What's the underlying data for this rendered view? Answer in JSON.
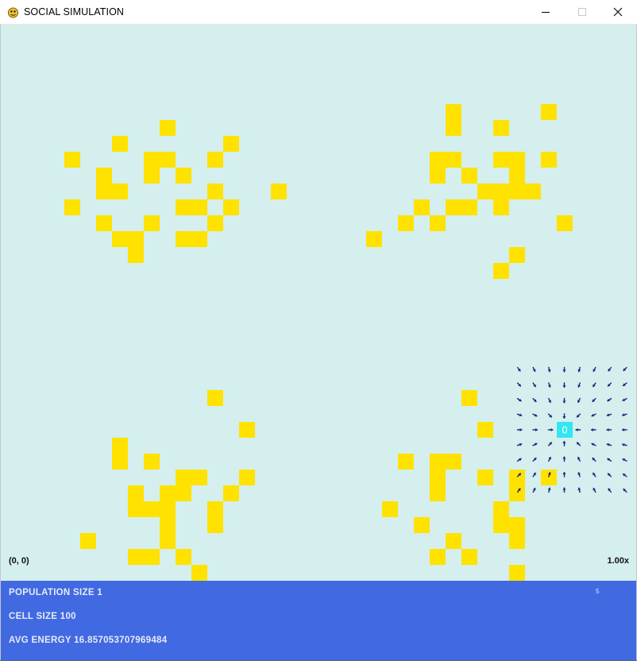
{
  "window": {
    "title": "SOCIAL SIMULATION",
    "icon": "pygame-snake-icon",
    "controls": [
      "minimize-icon",
      "maximize-icon",
      "close-icon"
    ]
  },
  "world": {
    "origin_label": "(0, 0)",
    "zoom_label": "1.00x",
    "agent_label": "0",
    "colors": {
      "background": "#d4efed",
      "food": "#ffe200",
      "agent": "#33e6f0",
      "field_arrows": "#1a237e"
    }
  },
  "panel": {
    "color": "#4169e1",
    "population": "POPULATION SIZE 1",
    "cell_size": "CELL SIZE 100",
    "avg_energy": "AVG ENERGY 16.857053707969484",
    "corner_number": "5"
  }
}
